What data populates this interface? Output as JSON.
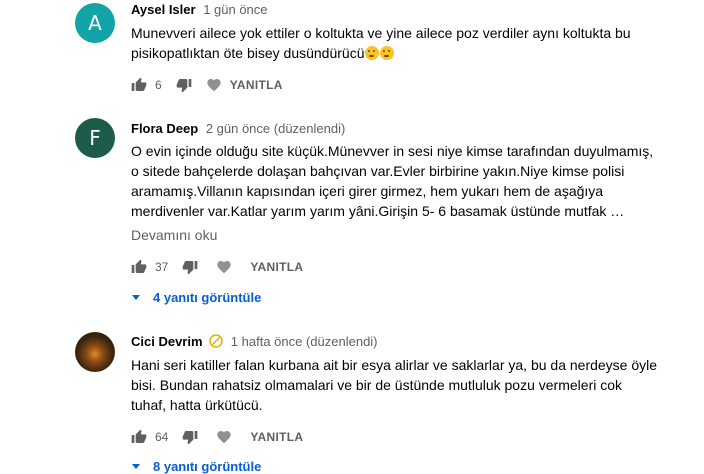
{
  "comments": [
    {
      "avatar_letter": "A",
      "avatar_color": "#12a4a6",
      "author": "Aysel Isler",
      "meta": "1 gün önce",
      "text_lines": [
        "Munevveri ailece yok ettiler o koltukta ve yine ailece poz verdiler aynı koltukta bu",
        "pisikopatlıktan öte bisey dusündürücü"
      ],
      "likes": "6",
      "reply_label": "YANITLA"
    },
    {
      "avatar_letter": "F",
      "avatar_color": "#1d5c4a",
      "author": "Flora Deep",
      "meta": "2 gün önce (düzenlendi)",
      "text_lines": [
        "O evin içinde olduğu site küçük.Münevver in sesi niye kimse tarafından duyulmamış,",
        "o sitede bahçelerde dolaşan bahçıvan var.Evler birbirine yakın.Niye kimse polisi",
        "aramamış.Villanın kapısından içeri girer girmez, hem yukarı hem de aşağıya",
        "merdivenler var.Katlar yarım yarım yâni.Girişin 5- 6 basamak üstünde mutfak …"
      ],
      "read_more": "Devamını oku",
      "likes": "37",
      "reply_label": "YANITLA",
      "view_replies": "4 yanıtı görüntüle"
    },
    {
      "author": "Cici Devrim",
      "meta": "1 hafta önce (düzenlendi)",
      "text_lines": [
        "Hani seri katiller falan kurbana ait bir esya alirlar ve saklarlar ya, bu da nerdeyse öyle",
        "bisi. Bundan rahatsiz olmamalari ve bir de üstünde mutluluk pozu vermeleri cok",
        "tuhaf, hatta ürkütücü."
      ],
      "likes": "64",
      "reply_label": "YANITLA",
      "view_replies": "8 yanıtı görüntüle"
    }
  ],
  "icons": [
    "thumb-up-icon",
    "thumb-down-icon",
    "heart-icon",
    "chevron-down-icon",
    "thinking-emoji-icon",
    "verified-badge-icon"
  ]
}
